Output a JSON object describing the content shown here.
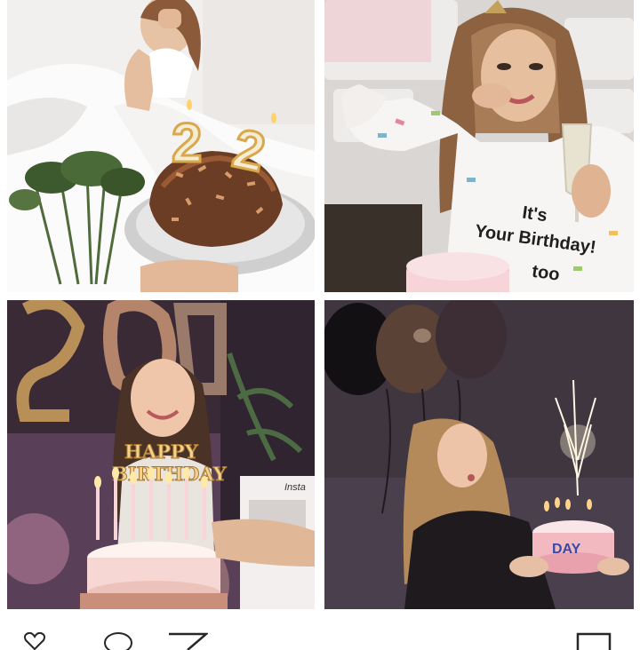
{
  "photos": [
    {
      "id": "bed-cake",
      "candle_digits": [
        "2",
        "2"
      ]
    },
    {
      "id": "birthday-shirt",
      "shirt_lines": [
        "It's",
        "Your Birthday!",
        "too"
      ]
    },
    {
      "id": "happy-birthday-sign",
      "sign_lines": [
        "HAPPY",
        "BIRTHDAY"
      ],
      "card_label": "Insta"
    },
    {
      "id": "sparkler-cake",
      "cake_label": "DAY"
    }
  ],
  "actions": {
    "icons": [
      "heart-icon",
      "comment-icon",
      "share-icon",
      "bookmark-icon"
    ]
  },
  "colors": {
    "gold": "#d9a84a",
    "cake_pink": "#f3b9c0",
    "ink": "#262626"
  }
}
